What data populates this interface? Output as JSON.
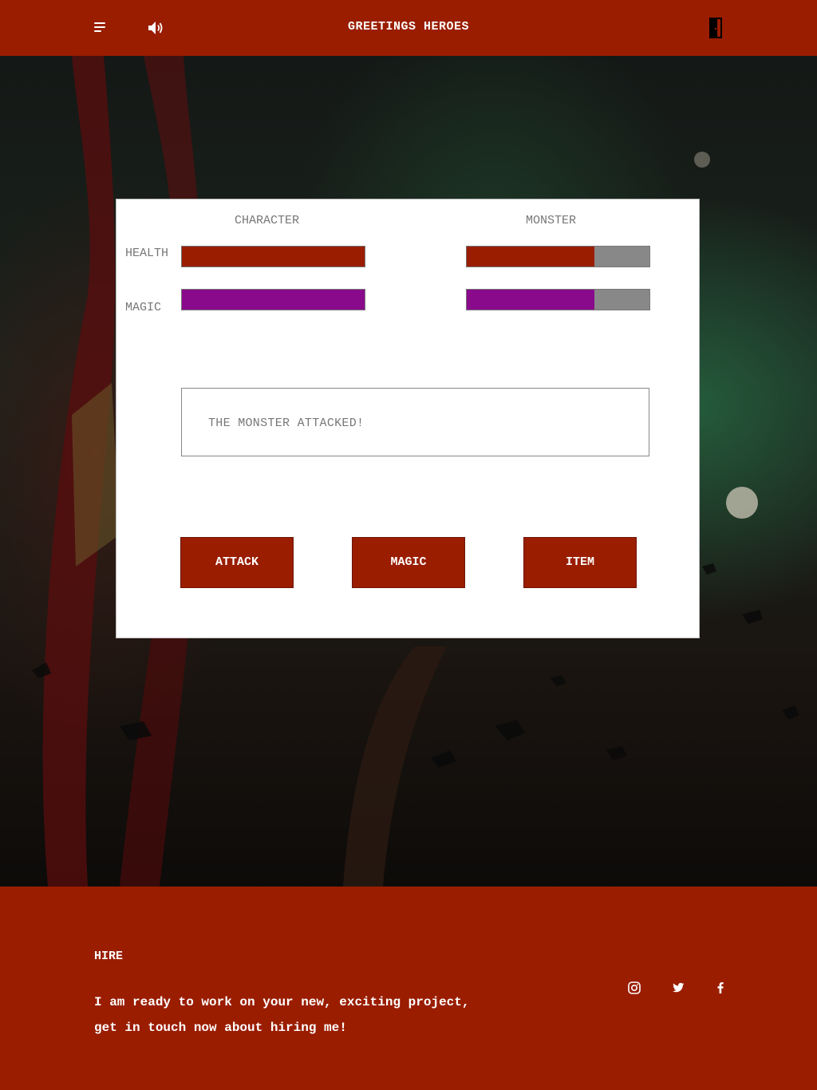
{
  "header": {
    "title": "GREETINGS HEROES",
    "menu_icon": "menu-icon",
    "sound_icon": "speaker-icon",
    "exit_icon": "door-exit-icon"
  },
  "battle": {
    "character_heading": "CHARACTER",
    "monster_heading": "MONSTER",
    "health_label": "HEALTH",
    "magic_label": "MAGIC",
    "character": {
      "health_pct": 100,
      "magic_pct": 100
    },
    "monster": {
      "health_pct": 70,
      "magic_pct": 70
    },
    "message": "THE MONSTER ATTACKED!",
    "actions": {
      "attack": "ATTACK",
      "magic": "MAGIC",
      "item": "ITEM"
    }
  },
  "footer": {
    "heading": "HIRE",
    "line1": "I am ready to work on your new, exciting project,",
    "line2": "get in touch now about hiring me!",
    "social": [
      "instagram-icon",
      "twitter-icon",
      "facebook-icon"
    ]
  },
  "colors": {
    "brand": "#9a1d00",
    "health": "#9a1d00",
    "magic": "#8a0a8c",
    "bar_empty": "#888888"
  }
}
